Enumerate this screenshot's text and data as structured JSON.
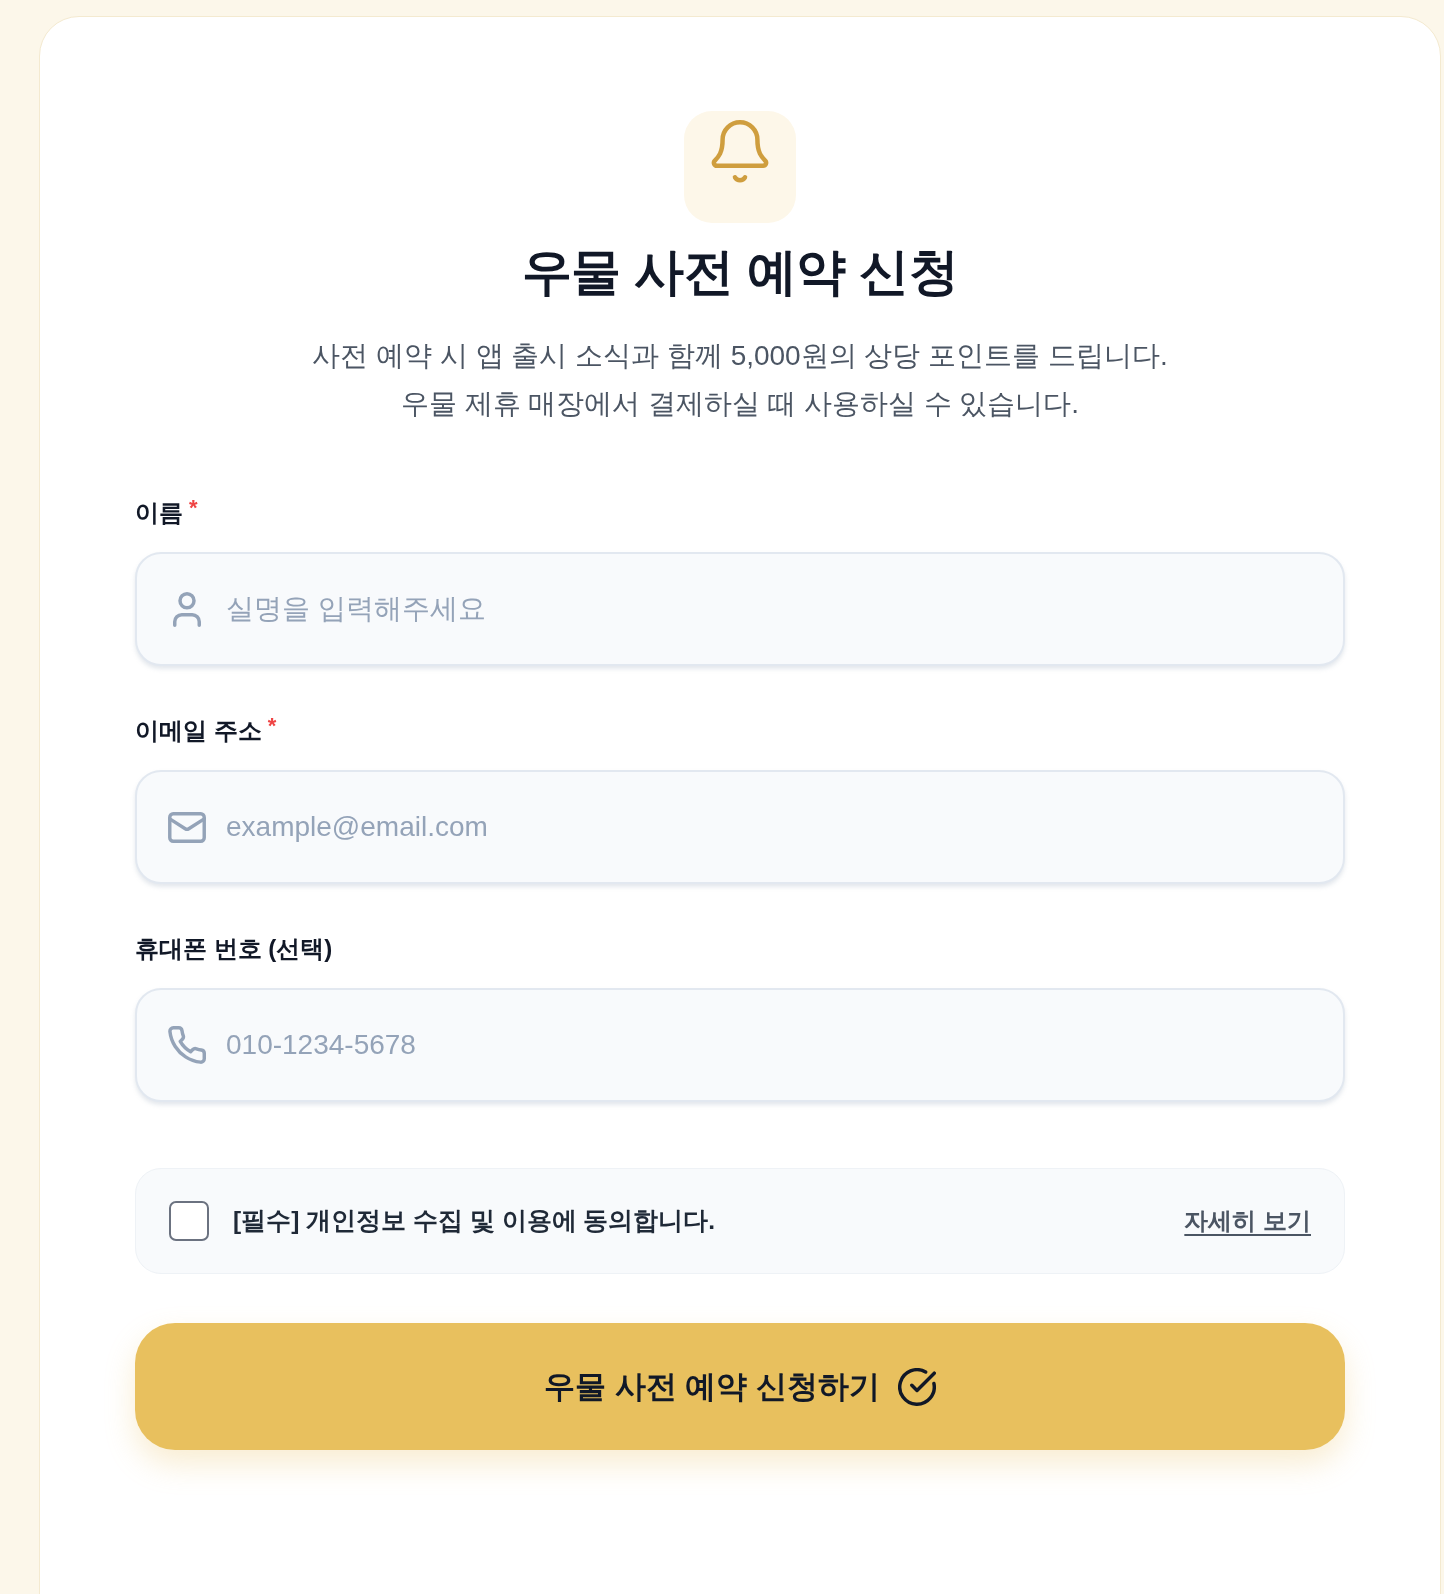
{
  "header": {
    "title": "우물 사전 예약 신청",
    "description": [
      "사전 예약 시 앱 출시 소식과 함께 5,000원의 상당 포인트를 드립니다.",
      "우물 제휴 매장에서 결제하실 때 사용하실 수 있습니다."
    ]
  },
  "required_mark": "*",
  "fields": [
    {
      "kind": "name",
      "label": "이름",
      "required": true,
      "placeholder": "실명을 입력해주세요"
    },
    {
      "kind": "email",
      "label": "이메일 주소",
      "required": true,
      "placeholder": "example@email.com"
    },
    {
      "kind": "phone",
      "label": "휴대폰 번호 (선택)",
      "required": false,
      "placeholder": "010-1234-5678"
    }
  ],
  "consent": {
    "checked": false,
    "label": "[필수] 개인정보 수집 및 이용에 동의합니다.",
    "link": "자세히 보기"
  },
  "submit_button": {
    "label": "우물 사전 예약 신청하기"
  }
}
